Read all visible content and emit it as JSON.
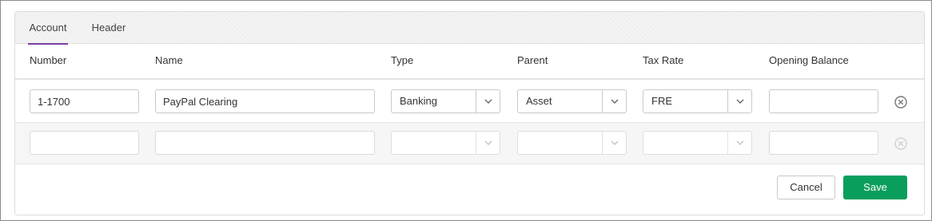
{
  "tabs": [
    {
      "label": "Account",
      "active": true
    },
    {
      "label": "Header",
      "active": false
    }
  ],
  "columns": [
    "Number",
    "Name",
    "Type",
    "Parent",
    "Tax Rate",
    "Opening Balance"
  ],
  "rows": [
    {
      "number": "1-1700",
      "name": "PayPal Clearing",
      "type": "Banking",
      "parent": "Asset",
      "tax_rate": "FRE",
      "opening_balance": ""
    },
    {
      "number": "",
      "name": "",
      "type": "",
      "parent": "",
      "tax_rate": "",
      "opening_balance": ""
    }
  ],
  "actions": {
    "cancel_label": "Cancel",
    "save_label": "Save"
  },
  "colors": {
    "accent_tab": "#7b3fa0",
    "save_green": "#0a9e5c"
  },
  "icons": {
    "dropdown": "chevron-down-icon",
    "remove": "remove-circle-icon"
  }
}
